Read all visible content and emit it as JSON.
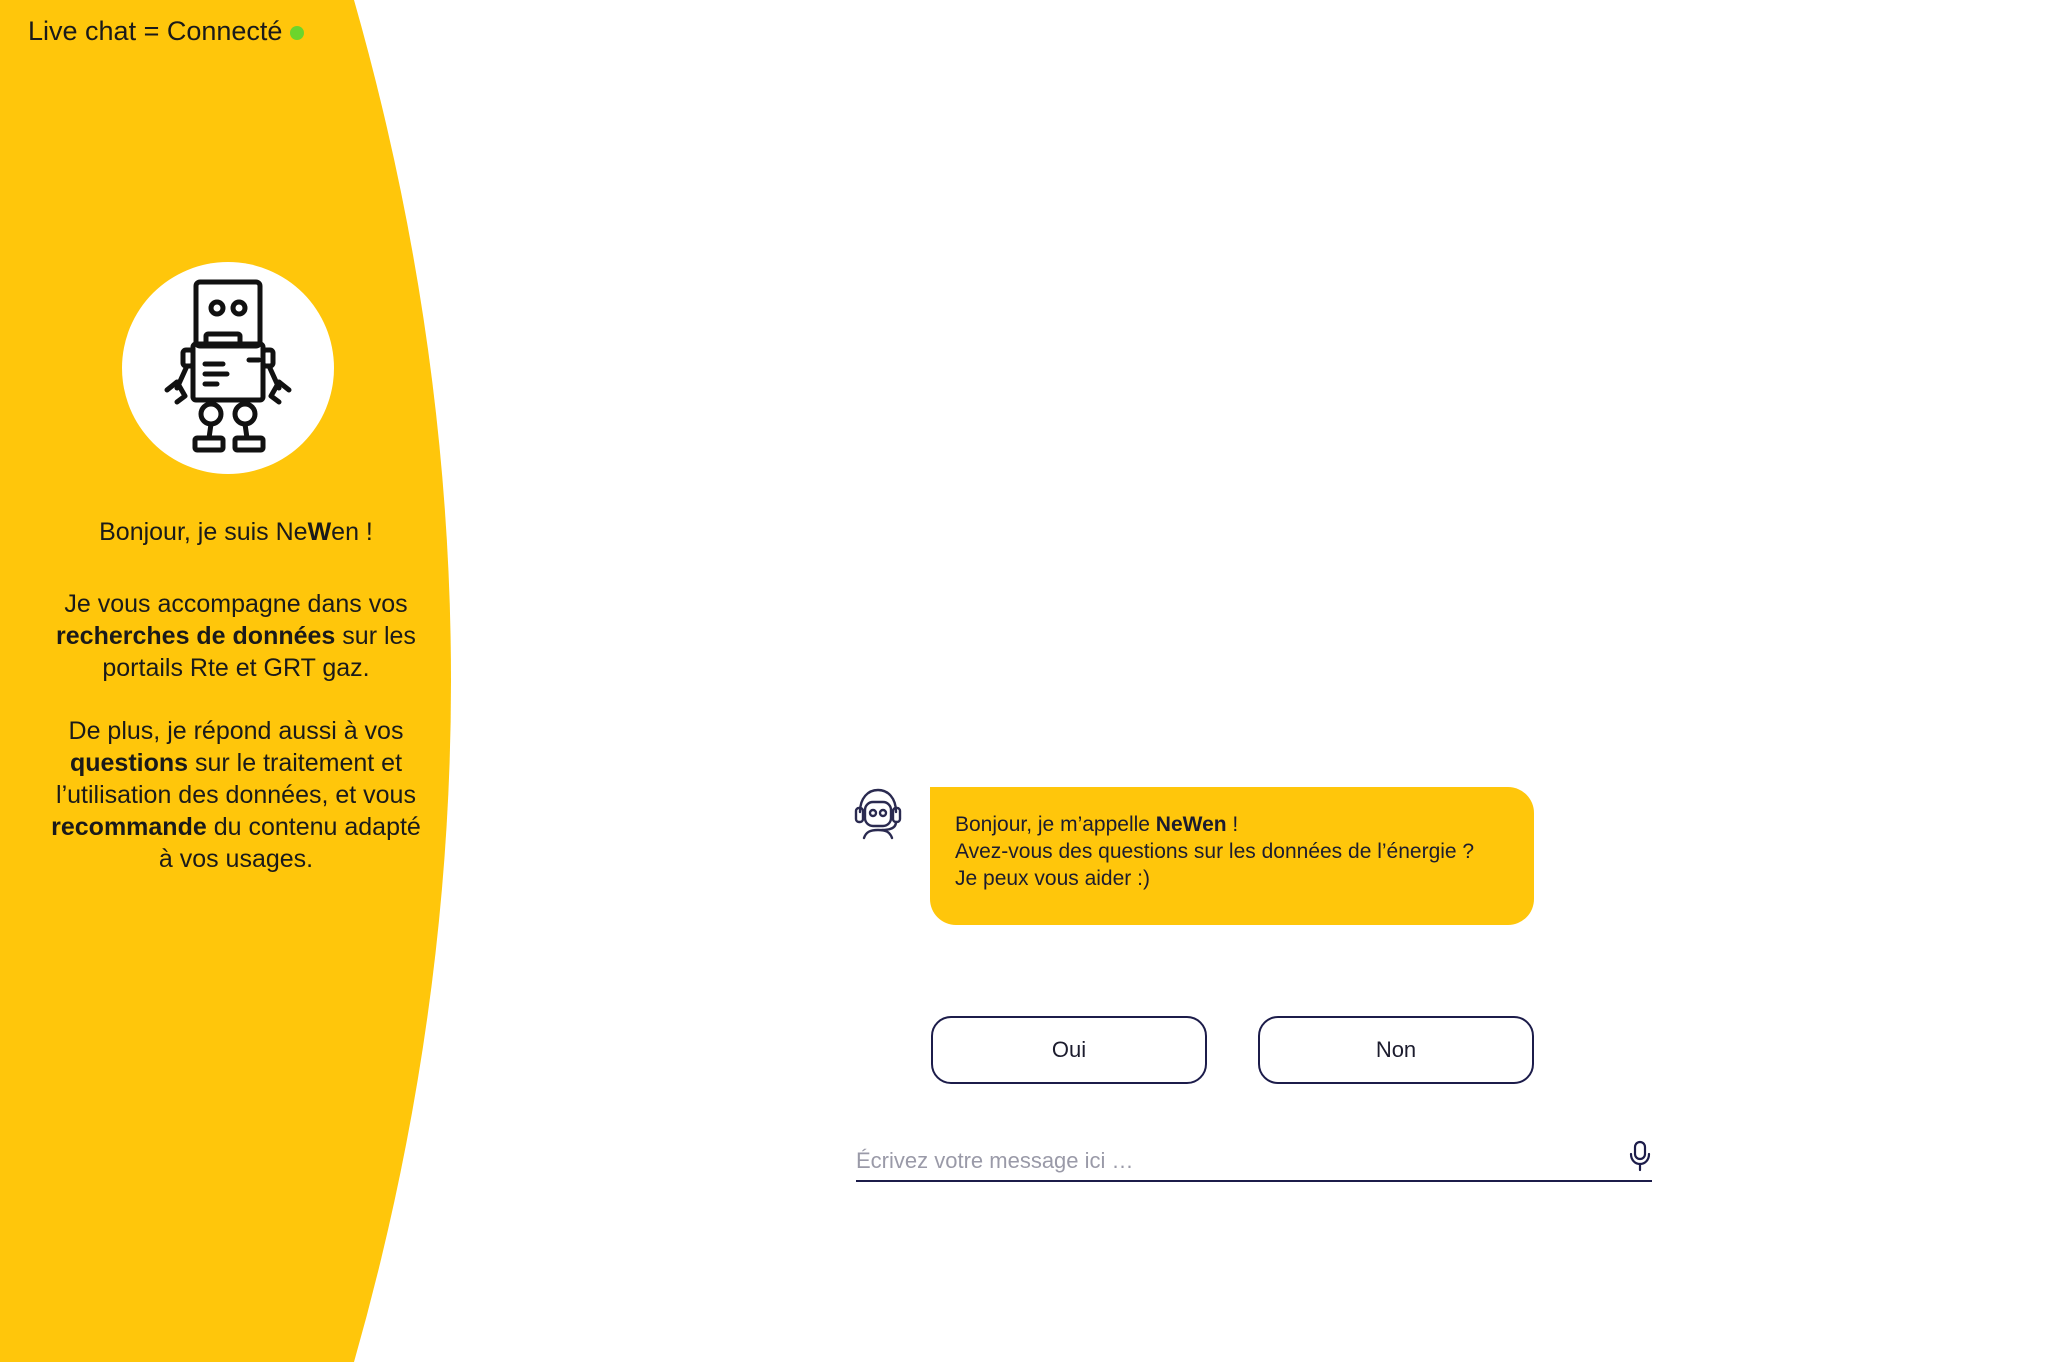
{
  "theme": {
    "accent": "#ffc60b",
    "status_dot": "#6cd52c",
    "ink": "#1c1c4a"
  },
  "status": {
    "label": "Live chat = Connecté",
    "dot_icon": "status-dot-icon"
  },
  "intro": {
    "greeting_prefix": "Bonjour, je suis Ne",
    "greeting_bold": "W",
    "greeting_suffix": "en !",
    "p1_a": "Je vous accompagne dans vos ",
    "p1_bold": "recherches de données",
    "p1_b": " sur les portails Rte et GRT gaz.",
    "p2_a": "De plus, je répond aussi à vos ",
    "p2_bold1": "questions",
    "p2_b": " sur le traitement et l’utilisation des données, et vous ",
    "p2_bold2": "recommande",
    "p2_c": " du contenu adapté à vos usages."
  },
  "chat": {
    "bot_avatar_icon": "robot-headset-icon",
    "message": {
      "line1_a": "Bonjour, je m’appelle ",
      "line1_bold": "NeWen",
      "line1_b": " !",
      "line2": "Avez-vous des questions sur les données de l’énergie ?",
      "line3": "Je peux vous aider  :)"
    },
    "quick_replies": [
      "Oui",
      "Non"
    ]
  },
  "composer": {
    "placeholder": "Écrivez votre message ici …",
    "value": "",
    "mic_icon": "microphone-icon"
  }
}
